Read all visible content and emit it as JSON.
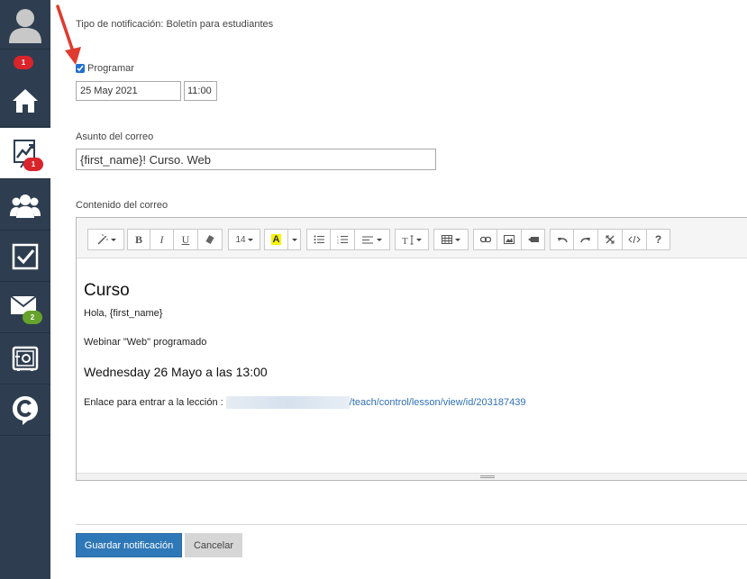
{
  "sidebar": {
    "badges": {
      "user": "1",
      "chart": "1",
      "mail": "2"
    },
    "icons": [
      "user-avatar-icon",
      "home-icon",
      "chart-icon",
      "group-icon",
      "checkbox-icon",
      "mail-icon",
      "safe-icon",
      "chat-logo-icon"
    ]
  },
  "notification": {
    "type_text": "Tipo de notificación: Boletín para estudiantes",
    "schedule_label": "Programar",
    "schedule_checked": true,
    "date_value": "25 May 2021",
    "time_value": "11:00"
  },
  "email": {
    "subject_label": "Asunto del correo",
    "subject_value": "{first_name}! Curso. Web",
    "content_label": "Contenido del correo"
  },
  "toolbar": {
    "font_size": "14"
  },
  "content": {
    "heading": "Curso",
    "greeting": "Hola, {first_name}",
    "webinar_line": "Webinar \"Web\" programado",
    "date_line": "Wednesday 26 Mayo a las 13:00",
    "link_prefix": "Enlace para entrar a la lección : ",
    "link_url": "/teach/control/lesson/view/id/203187439"
  },
  "actions": {
    "save_label": "Guardar notificación",
    "cancel_label": "Cancelar"
  },
  "colors": {
    "sidebar_bg": "#2e3e50",
    "primary_button": "#2f78b8",
    "link": "#2f6fb5",
    "arrow": "#e03b2f"
  }
}
